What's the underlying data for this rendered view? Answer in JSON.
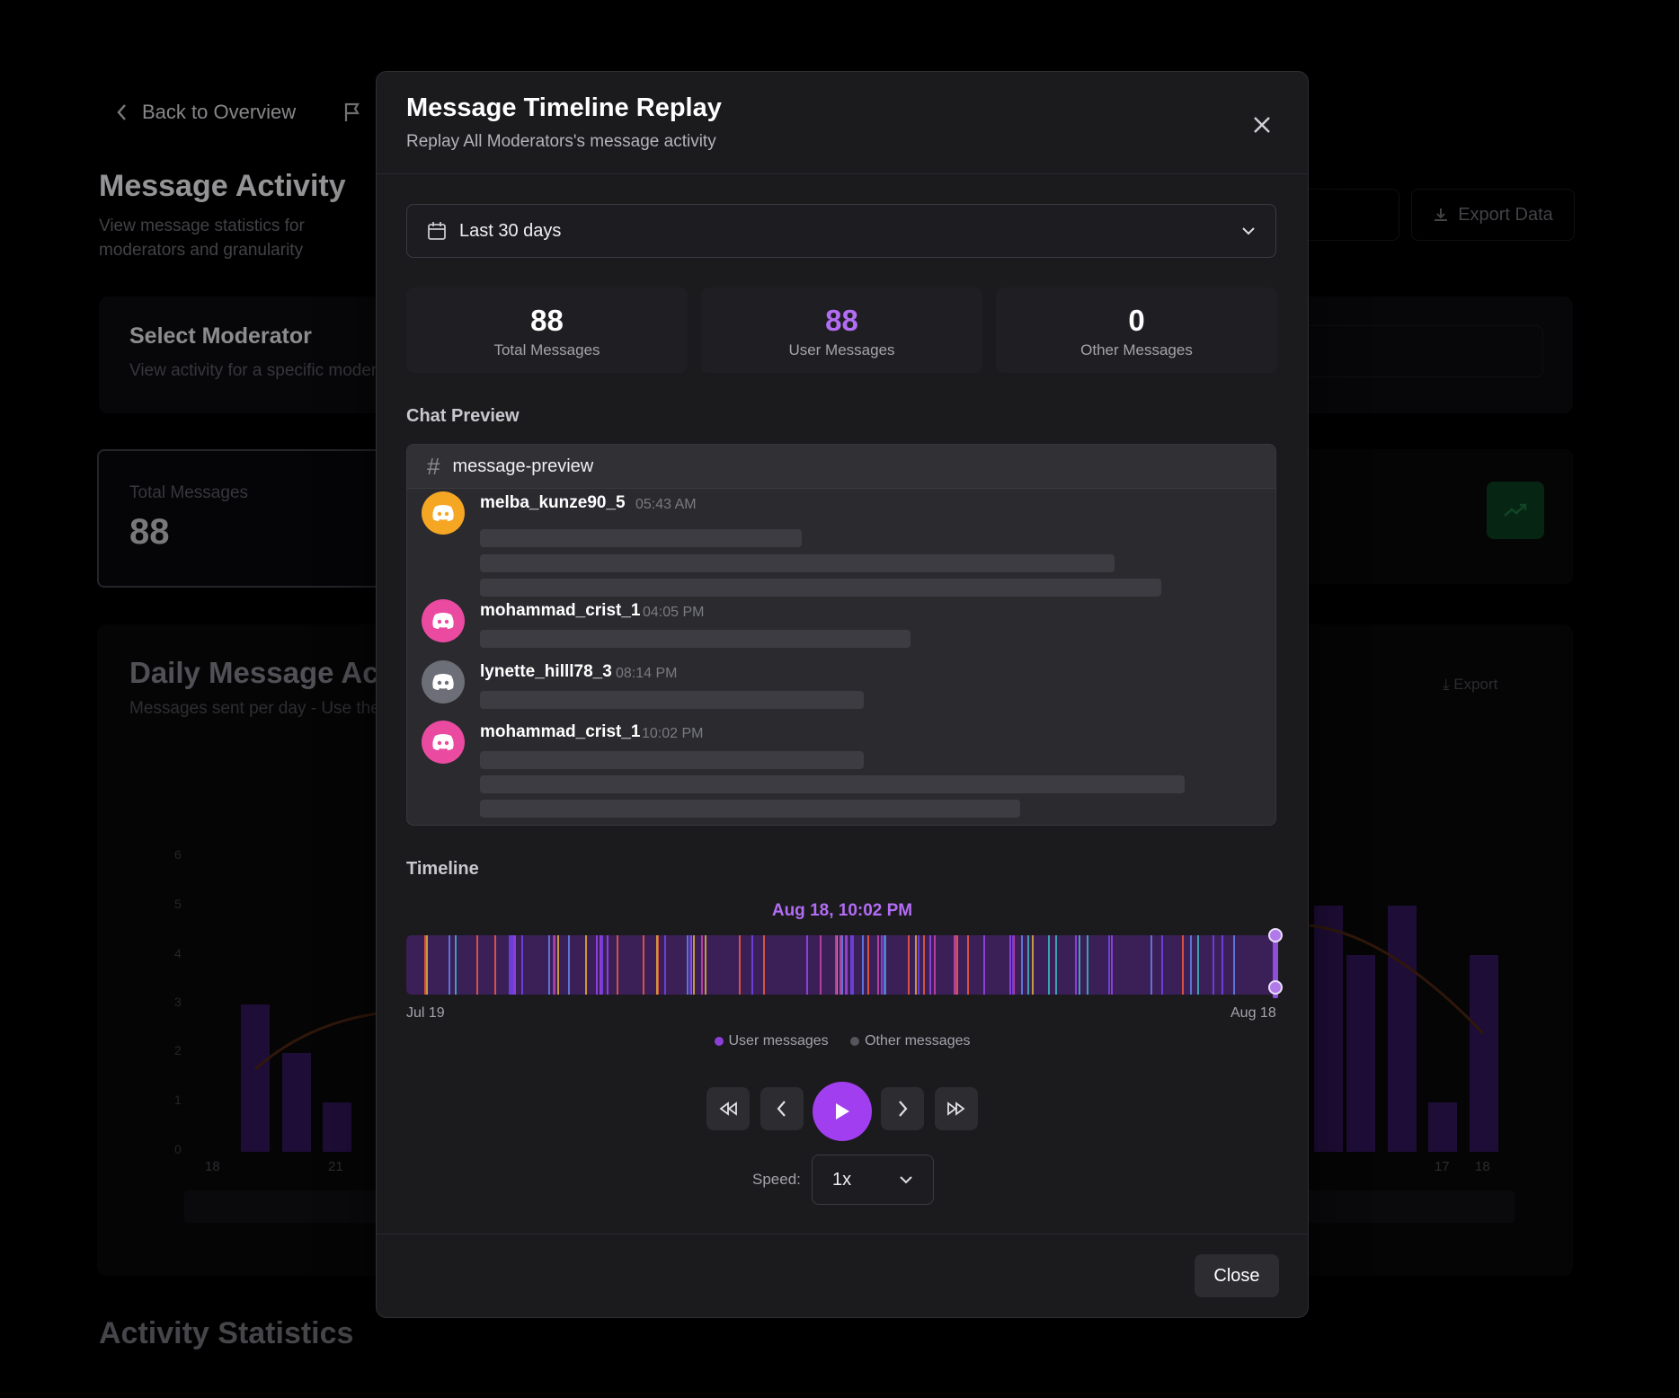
{
  "background": {
    "back_label": "Back to Overview",
    "page_title": "Message Activity",
    "page_subtitle": "View message statistics for moderators and granularity",
    "export_label": "Export Data",
    "select_title": "Select Moderator",
    "select_sub": "View activity for a specific moderator",
    "total_label": "Total Messages",
    "total_value": "88",
    "daily_title": "Daily Message Activity",
    "daily_sub": "Messages sent per day - Use the slider",
    "chart_export": "Export",
    "y_ticks": [
      "6",
      "5",
      "4",
      "3",
      "2",
      "1",
      "0"
    ],
    "x_ticks_left": [
      "18",
      "21"
    ],
    "x_ticks_right": [
      "17",
      "18"
    ],
    "bars_left": [
      3,
      2,
      1
    ],
    "bars_right": [
      5,
      4,
      5,
      1,
      4
    ],
    "activity_title": "Activity Statistics"
  },
  "modal": {
    "title": "Message Timeline Replay",
    "subtitle": "Replay All Moderators's message activity",
    "range_label": "Last 30 days",
    "stats": [
      {
        "value": "88",
        "caption": "Total Messages",
        "color": "#ffffff"
      },
      {
        "value": "88",
        "caption": "User Messages",
        "color": "#b36cf4"
      },
      {
        "value": "0",
        "caption": "Other Messages",
        "color": "#ffffff"
      }
    ],
    "chat_preview_label": "Chat Preview",
    "channel": "message-preview",
    "messages": [
      {
        "user": "melba_kunze90_5",
        "time": "05:43 AM",
        "avatar_color": "#f5a623"
      },
      {
        "user": "mohammad_crist_1",
        "time": "04:05 PM",
        "avatar_color": "#ea4aa0"
      },
      {
        "user": "lynette_hilll78_3",
        "time": "08:14 PM",
        "avatar_color": "#6d6f78"
      },
      {
        "user": "mohammad_crist_1",
        "time": "10:02 PM",
        "avatar_color": "#ea4aa0"
      }
    ],
    "timeline_label": "Timeline",
    "current_time": "Aug 18, 10:02 PM",
    "start_date": "Jul 19",
    "end_date": "Aug 18",
    "legend_user": "User messages",
    "legend_other": "Other messages",
    "legend_user_color": "#8b3fd6",
    "legend_other_color": "#55555c",
    "speed_label": "Speed:",
    "speed_value": "1x",
    "close_label": "Close",
    "accent_color": "#a13ef0"
  }
}
